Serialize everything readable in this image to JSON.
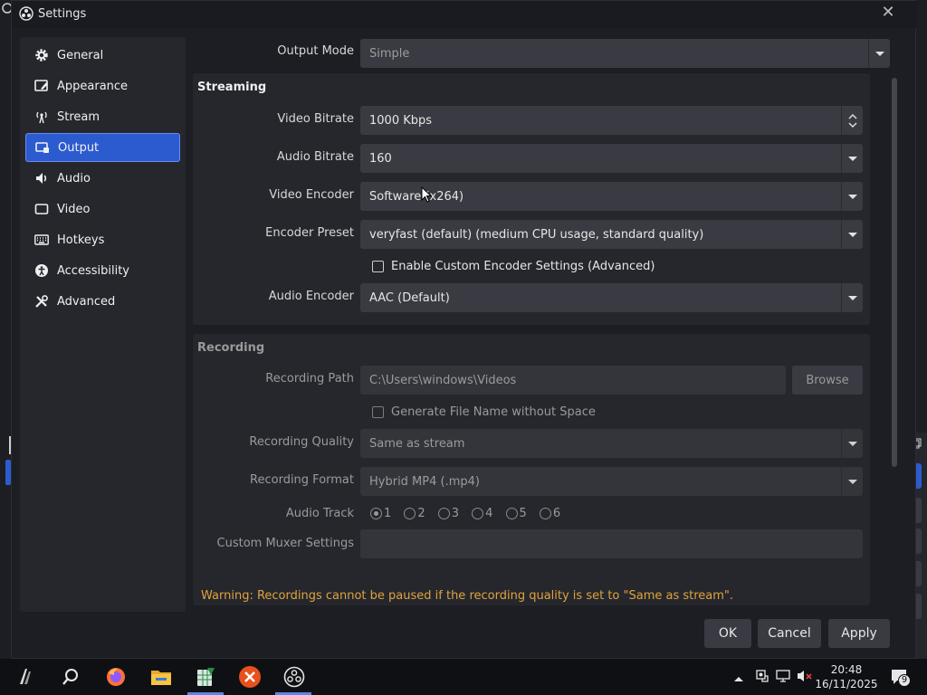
{
  "window": {
    "title": "Settings",
    "icon": "obs-icon",
    "close_icon": "close-icon"
  },
  "sidebar": {
    "items": [
      {
        "label": "General",
        "icon": "gear-icon"
      },
      {
        "label": "Appearance",
        "icon": "appearance-icon"
      },
      {
        "label": "Stream",
        "icon": "antenna-icon"
      },
      {
        "label": "Output",
        "icon": "output-icon",
        "active": true
      },
      {
        "label": "Audio",
        "icon": "speaker-icon"
      },
      {
        "label": "Video",
        "icon": "monitor-icon"
      },
      {
        "label": "Hotkeys",
        "icon": "keyboard-icon"
      },
      {
        "label": "Accessibility",
        "icon": "accessibility-icon"
      },
      {
        "label": "Advanced",
        "icon": "tools-icon"
      }
    ],
    "accent": "#2c5bd0"
  },
  "output_mode": {
    "label": "Output Mode",
    "value": "Simple"
  },
  "streaming": {
    "title": "Streaming",
    "video_bitrate": {
      "label": "Video Bitrate",
      "value": "1000 Kbps"
    },
    "audio_bitrate": {
      "label": "Audio Bitrate",
      "value": "160"
    },
    "video_encoder": {
      "label": "Video Encoder",
      "value": "Software (x264)"
    },
    "encoder_preset": {
      "label": "Encoder Preset",
      "value": "veryfast (default) (medium CPU usage, standard quality)"
    },
    "custom_encoder_settings": {
      "label": "Enable Custom Encoder Settings (Advanced)",
      "checked": false
    },
    "audio_encoder": {
      "label": "Audio Encoder",
      "value": "AAC (Default)"
    }
  },
  "recording": {
    "title": "Recording",
    "path": {
      "label": "Recording Path",
      "value": "C:\\Users\\windows\\Videos",
      "browse": "Browse"
    },
    "no_space": {
      "label": "Generate File Name without Space",
      "checked": false
    },
    "quality": {
      "label": "Recording Quality",
      "value": "Same as stream"
    },
    "format": {
      "label": "Recording Format",
      "value": "Hybrid MP4 (.mp4)"
    },
    "audio_track": {
      "label": "Audio Track",
      "tracks": [
        "1",
        "2",
        "3",
        "4",
        "5",
        "6"
      ],
      "selected": "1"
    },
    "muxer": {
      "label": "Custom Muxer Settings",
      "value": ""
    }
  },
  "warning": "Warning: Recordings cannot be paused if the recording quality is set to \"Same as stream\".",
  "buttons": {
    "ok": "OK",
    "cancel": "Cancel",
    "apply": "Apply"
  },
  "taskbar": {
    "apps": [
      "start-icon",
      "search-icon",
      "firefox-icon",
      "file-explorer-icon",
      "spreadsheet-icon",
      "x-app-icon",
      "obs-icon"
    ],
    "time": "20:48",
    "date": "16/11/2025",
    "notification_count": "9"
  },
  "colors": {
    "warning": "#e0a33c",
    "accent": "#2c5bd0"
  }
}
